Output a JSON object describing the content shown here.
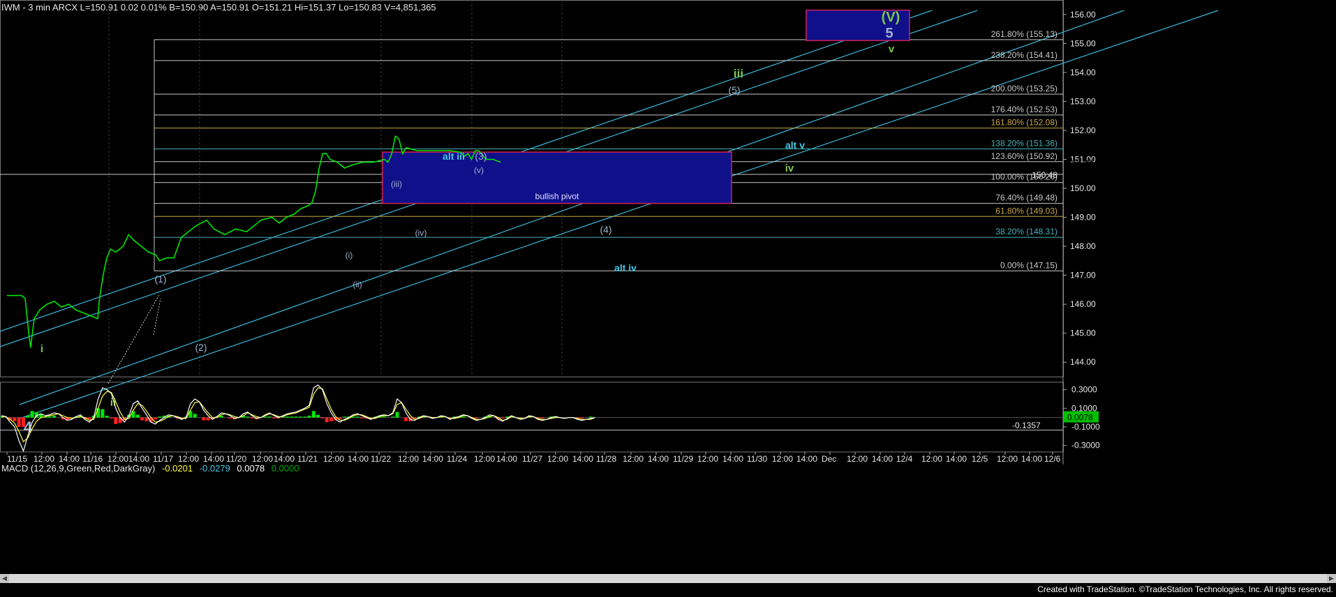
{
  "header": {
    "symbol_line": "IWM - 3 min  ARCX  L=150.91  0.02  0.01%  B=150.90  A=150.91  O=151.21  Hi=151.37  Lo=150.83  V=4,851,365"
  },
  "macd_header": {
    "name": "MACD (12,26,9,Green,Red,DarkGray)",
    "v1": "-0.0201",
    "v2": "-0.0279",
    "v3": "0.0078",
    "v4": "0.0000"
  },
  "footer": {
    "text": "Created with TradeStation. ©TradeStation Technologies, Inc. All rights reserved."
  },
  "colors": {
    "price": "#00e600",
    "fib_line": "#c8c8c8",
    "channel": "#39b8d8",
    "box_fill": "#10108a",
    "box_border": "#d0205a",
    "macd_line": "#ffffff",
    "signal_line": "#ffff40",
    "hist_pos": "#00e600",
    "hist_neg": "#ff2020",
    "label_green": "#7ec84a",
    "label_cyan": "#46c8e6",
    "label_gray": "#a0b4d0"
  },
  "chart_data": [
    {
      "type": "line",
      "title": "IWM - 3 min",
      "x_axis_labels": [
        "11/15",
        "12:00",
        "14:00",
        "11/16",
        "12:00",
        "14:00",
        "11/17",
        "12:00",
        "14:00",
        "11/20",
        "12:00",
        "14:00",
        "11/21",
        "12:00",
        "14:00",
        "11/22",
        "12:00",
        "14:00",
        "11/24",
        "12:00",
        "14:00",
        "11/27",
        "12:00",
        "14:00",
        "11/28",
        "12:00",
        "14:00",
        "11/29",
        "12:00",
        "14:00",
        "11/30",
        "12:00",
        "14:00",
        "Dec",
        "12:00",
        "14:00",
        "12/4",
        "12:00",
        "14:00",
        "12/5",
        "12:00",
        "14:00",
        "12/6"
      ],
      "ylim": [
        143.5,
        156.5
      ],
      "y_ticks": [
        "144.00",
        "145.00",
        "146.00",
        "147.00",
        "148.00",
        "149.00",
        "150.00",
        "151.00",
        "152.00",
        "153.00",
        "154.00",
        "155.00",
        "156.00"
      ],
      "last_price": "150.90",
      "extra_price_label": "150.48",
      "price_path": [
        [
          0,
          146.3
        ],
        [
          4,
          146.3
        ],
        [
          5,
          146.2
        ],
        [
          6,
          145.0
        ],
        [
          6.5,
          144.5
        ],
        [
          7.5,
          145.5
        ],
        [
          9,
          145.8
        ],
        [
          11,
          146.0
        ],
        [
          13,
          146.1
        ],
        [
          15,
          145.9
        ],
        [
          17,
          146.0
        ],
        [
          19,
          145.8
        ],
        [
          21,
          145.7
        ],
        [
          23,
          145.6
        ],
        [
          25,
          145.5
        ],
        [
          25.5,
          146.2
        ],
        [
          26.5,
          147.0
        ],
        [
          27.5,
          147.6
        ],
        [
          28.5,
          147.9
        ],
        [
          30,
          147.8
        ],
        [
          32,
          148.0
        ],
        [
          33.5,
          148.4
        ],
        [
          35,
          148.2
        ],
        [
          37,
          148.0
        ],
        [
          39,
          147.8
        ],
        [
          41,
          147.7
        ],
        [
          42,
          147.5
        ],
        [
          44,
          147.6
        ],
        [
          46,
          147.6
        ],
        [
          48,
          148.3
        ],
        [
          50,
          148.5
        ],
        [
          52,
          148.7
        ],
        [
          55,
          148.9
        ],
        [
          57,
          148.6
        ],
        [
          60,
          148.4
        ],
        [
          63,
          148.6
        ],
        [
          66,
          148.5
        ],
        [
          68,
          148.7
        ],
        [
          70,
          148.9
        ],
        [
          73,
          149.0
        ],
        [
          75,
          148.8
        ],
        [
          77,
          149.0
        ],
        [
          79,
          149.1
        ],
        [
          81,
          149.3
        ],
        [
          83,
          149.4
        ],
        [
          84,
          149.5
        ],
        [
          85,
          149.9
        ],
        [
          86,
          150.7
        ],
        [
          87,
          151.2
        ],
        [
          88,
          151.2
        ],
        [
          89,
          151.0
        ],
        [
          91,
          150.9
        ],
        [
          93,
          150.7
        ],
        [
          95,
          150.8
        ],
        [
          98,
          150.9
        ],
        [
          101,
          150.9
        ],
        [
          104,
          151.0
        ],
        [
          105,
          150.9
        ],
        [
          106,
          151.2
        ],
        [
          107,
          151.8
        ],
        [
          108,
          151.7
        ],
        [
          109,
          151.2
        ],
        [
          110,
          151.4
        ],
        [
          113,
          151.3
        ],
        [
          116,
          151.3
        ],
        [
          119,
          151.3
        ],
        [
          122,
          151.3
        ],
        [
          125,
          151.25
        ],
        [
          126,
          151.1
        ],
        [
          127,
          151.2
        ],
        [
          128,
          151.0
        ],
        [
          129,
          151.3
        ],
        [
          130,
          151.3
        ],
        [
          132,
          151.0
        ],
        [
          134,
          151.0
        ],
        [
          136,
          150.9
        ]
      ],
      "fib_levels": [
        {
          "label": "261.80% (155.13)",
          "value": 155.13,
          "color": "#c8c8c8"
        },
        {
          "label": "238.20% (154.41)",
          "value": 154.41,
          "color": "#c8c8c8"
        },
        {
          "label": "200.00% (153.25)",
          "value": 153.25,
          "color": "#c8c8c8"
        },
        {
          "label": "176.40% (152.53)",
          "value": 152.53,
          "color": "#c8c8c8"
        },
        {
          "label": "161.80% (152.08)",
          "value": 152.08,
          "color": "#c8a848"
        },
        {
          "label": "138.20% (151.36)",
          "value": 151.36,
          "color": "#48b0b8"
        },
        {
          "label": "123.60% (150.92)",
          "value": 150.92,
          "color": "#c8c8c8"
        },
        {
          "label": "100.00% (150.20)",
          "value": 150.2,
          "color": "#c8c8c8"
        },
        {
          "label": "76.40% (149.48)",
          "value": 149.48,
          "color": "#c8c8c8"
        },
        {
          "label": "61.80% (149.03)",
          "value": 149.03,
          "color": "#c8a848"
        },
        {
          "label": "38.20% (148.31)",
          "value": 148.31,
          "color": "#48b0b8"
        },
        {
          "label": "0.00% (147.15)",
          "value": 147.15,
          "color": "#c8c8c8"
        }
      ],
      "boxes": [
        {
          "label": "bullish pivot",
          "y_low": 149.48,
          "y_high": 151.25
        },
        {
          "label": "",
          "y_low": 155.1,
          "y_high": 156.15
        }
      ],
      "wave_labels": [
        {
          "text": "4",
          "color": "#a0b4d0"
        },
        {
          "text": "i",
          "color": "#7ec84a"
        },
        {
          "text": "ii",
          "color": "#7ec84a"
        },
        {
          "text": "(1)",
          "color": "#a0b4d0"
        },
        {
          "text": "(2)",
          "color": "#a0b4d0"
        },
        {
          "text": "(i)",
          "color": "#a0b4d0"
        },
        {
          "text": "(ii)",
          "color": "#a0b4d0"
        },
        {
          "text": "(iii)",
          "color": "#a0b4d0"
        },
        {
          "text": "(iv)",
          "color": "#a0b4d0"
        },
        {
          "text": "(v)",
          "color": "#a0b4d0"
        },
        {
          "text": "alt iii",
          "color": "#46c8e6"
        },
        {
          "text": "(3)",
          "color": "#a0b4d0"
        },
        {
          "text": "(4)",
          "color": "#a0b4d0"
        },
        {
          "text": "alt iv",
          "color": "#46c8e6"
        },
        {
          "text": "iii",
          "color": "#7ec84a"
        },
        {
          "text": "(5)",
          "color": "#a0b4d0"
        },
        {
          "text": "alt v",
          "color": "#46c8e6"
        },
        {
          "text": "iv",
          "color": "#7ec84a"
        },
        {
          "text": "(V)",
          "color": "#7ec84a"
        },
        {
          "text": "5",
          "color": "#a0b4d0"
        },
        {
          "text": "v",
          "color": "#7ec84a"
        }
      ]
    },
    {
      "type": "line",
      "title": "MACD (12,26,9,Green,Red,DarkGray)",
      "ylim": [
        -0.37,
        0.38
      ],
      "y_ticks": [
        "0.3000",
        "0.1000",
        "-0.1000",
        "-0.3000"
      ],
      "current_value": "0.0078",
      "reference_value": "-0.1357",
      "series": [
        {
          "name": "MACD",
          "values": [
            0.02,
            0.01,
            -0.05,
            -0.1,
            -0.25,
            -0.36,
            -0.2,
            -0.05,
            0.02,
            0.04,
            0.02,
            0.03,
            0.05,
            0.04,
            0.0,
            -0.03,
            -0.02,
            0.01,
            0.03,
            -0.02,
            -0.05,
            0.0,
            0.2,
            0.32,
            0.3,
            0.26,
            0.1,
            0.0,
            -0.05,
            0.02,
            0.15,
            0.18,
            0.1,
            0.03,
            -0.05,
            -0.07,
            -0.03,
            0.0,
            0.03,
            0.02,
            0.0,
            -0.02,
            0.0,
            0.15,
            0.2,
            0.17,
            0.08,
            0.02,
            -0.02,
            0.01,
            0.05,
            0.04,
            0.02,
            -0.01,
            0.0,
            0.04,
            0.06,
            0.02,
            -0.01,
            0.0,
            0.03,
            0.05,
            0.02,
            0.0,
            0.02,
            0.04,
            0.05,
            0.06,
            0.08,
            0.1,
            0.13,
            0.32,
            0.35,
            0.3,
            0.15,
            0.05,
            -0.02,
            -0.05,
            -0.02,
            0.0,
            0.03,
            0.04,
            0.02,
            0.0,
            -0.02,
            0.0,
            0.02,
            0.03,
            0.02,
            0.05,
            0.2,
            0.16,
            0.05,
            -0.02,
            -0.03,
            0.0,
            0.02,
            0.01,
            -0.01,
            0.0,
            0.02,
            0.01,
            -0.02,
            0.0,
            0.01,
            0.03,
            0.02,
            -0.01,
            -0.03,
            -0.02,
            0.0,
            0.03,
            0.02,
            -0.02,
            -0.04,
            -0.01,
            0.02,
            0.0,
            -0.02,
            -0.01,
            0.02,
            0.01,
            -0.02,
            -0.03,
            -0.02,
            0.0,
            0.01,
            0.0,
            -0.01,
            0.0,
            0.0,
            -0.02,
            -0.03,
            -0.02,
            -0.01,
            0.0
          ]
        },
        {
          "name": "Signal",
          "values": [
            0.01,
            0.01,
            -0.02,
            -0.06,
            -0.15,
            -0.26,
            -0.22,
            -0.12,
            -0.04,
            0.0,
            0.01,
            0.02,
            0.03,
            0.04,
            0.02,
            0.0,
            -0.01,
            0.0,
            0.01,
            0.0,
            -0.03,
            -0.02,
            0.1,
            0.23,
            0.28,
            0.27,
            0.17,
            0.06,
            -0.02,
            -0.01,
            0.08,
            0.15,
            0.13,
            0.07,
            0.0,
            -0.05,
            -0.04,
            -0.02,
            0.01,
            0.02,
            0.01,
            -0.01,
            -0.01,
            0.08,
            0.16,
            0.17,
            0.11,
            0.05,
            0.0,
            0.0,
            0.03,
            0.04,
            0.03,
            0.01,
            0.0,
            0.02,
            0.05,
            0.03,
            0.01,
            0.0,
            0.02,
            0.04,
            0.03,
            0.01,
            0.01,
            0.03,
            0.04,
            0.05,
            0.07,
            0.09,
            0.11,
            0.25,
            0.32,
            0.31,
            0.2,
            0.09,
            0.01,
            -0.03,
            -0.03,
            -0.01,
            0.02,
            0.03,
            0.03,
            0.01,
            -0.01,
            -0.01,
            0.01,
            0.02,
            0.02,
            0.04,
            0.14,
            0.16,
            0.09,
            0.02,
            -0.02,
            -0.01,
            0.01,
            0.01,
            0.0,
            0.0,
            0.01,
            0.01,
            -0.01,
            -0.01,
            0.0,
            0.02,
            0.02,
            0.0,
            -0.02,
            -0.02,
            -0.01,
            0.01,
            0.02,
            0.0,
            -0.03,
            -0.02,
            0.01,
            0.0,
            -0.01,
            -0.01,
            0.01,
            0.01,
            -0.01,
            -0.02,
            -0.02,
            -0.01,
            0.0,
            0.0,
            -0.01,
            0.0,
            0.0,
            -0.01,
            -0.02,
            -0.02,
            -0.02,
            0.0
          ]
        }
      ]
    }
  ]
}
